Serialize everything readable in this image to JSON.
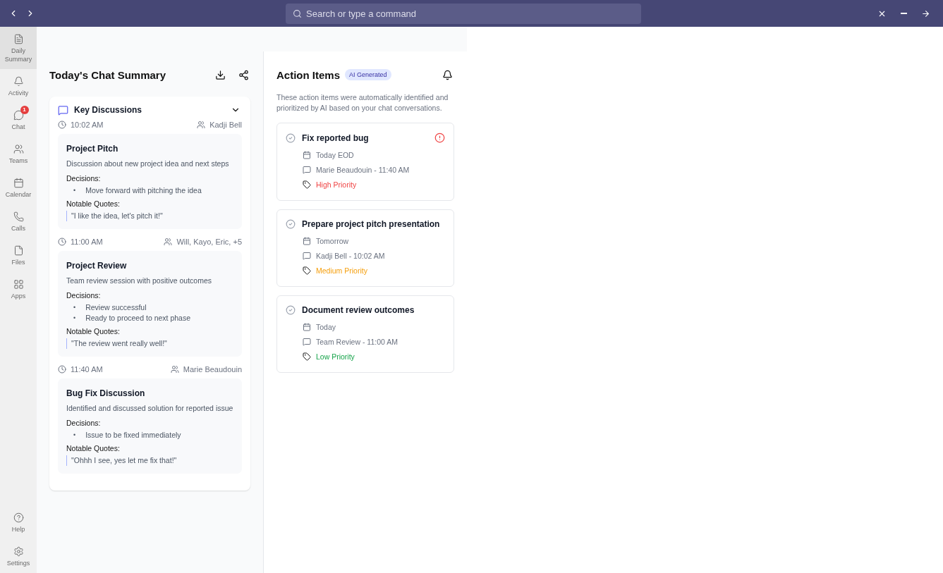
{
  "titlebar": {
    "search": {
      "placeholder": "Search or type a command"
    }
  },
  "sidebar": {
    "items": [
      {
        "kind": "summary",
        "label": "Daily Summary",
        "selected": true
      },
      {
        "kind": "activity",
        "label": "Activity",
        "selected": false
      },
      {
        "kind": "chat",
        "label": "Chat",
        "selected": false,
        "badge": "1"
      },
      {
        "kind": "teams",
        "label": "Teams",
        "selected": false
      },
      {
        "kind": "calendar",
        "label": "Calendar",
        "selected": false
      },
      {
        "kind": "calls",
        "label": "Calls",
        "selected": false
      },
      {
        "kind": "files",
        "label": "Files",
        "selected": false
      },
      {
        "kind": "apps",
        "label": "Apps",
        "selected": false
      }
    ],
    "bottom_items": [
      {
        "kind": "help",
        "label": "Help",
        "selected": false
      },
      {
        "kind": "settings",
        "label": "Settings",
        "selected": false
      }
    ]
  },
  "summary": {
    "title": "Today's Chat Summary",
    "key_discussions": {
      "title": "Key Discussions",
      "expanded": true,
      "bullet": "•",
      "entries": [
        {
          "time": "10:02 AM",
          "participants": "Kadji Bell",
          "title": "Project Pitch",
          "description": "Discussion about new project idea and next steps",
          "decisions_label": "Decisions:",
          "decisions": [
            "Move forward with pitching the idea"
          ],
          "quotes_label": "Notable Quotes:",
          "quotes": [
            "\"I like the idea, let's pitch it!\""
          ]
        },
        {
          "time": "11:00 AM",
          "participants": "Will, Kayo, Eric, +5",
          "title": "Project Review",
          "description": "Team review session with positive outcomes",
          "decisions_label": "Decisions:",
          "decisions": [
            "Review successful",
            "Ready to proceed to next phase"
          ],
          "quotes_label": "Notable Quotes:",
          "quotes": [
            "\"The review went really well!\""
          ]
        },
        {
          "time": "11:40 AM",
          "participants": "Marie Beaudouin",
          "title": "Bug Fix Discussion",
          "description": "Identified and discussed solution for reported issue",
          "decisions_label": "Decisions:",
          "decisions": [
            "Issue to be fixed immediately"
          ],
          "quotes_label": "Notable Quotes:",
          "quotes": [
            "\"Ohhh I see, yes let me fix that!\""
          ]
        }
      ]
    }
  },
  "action_items": {
    "title": "Action Items",
    "badge": "AI Generated",
    "description": "These action items were automatically identified and prioritized by AI based on your chat conversations.",
    "items": [
      {
        "title": "Fix reported bug",
        "due": "Today EOD",
        "source": "Marie Beaudouin - 11:40 AM",
        "priority": "High Priority",
        "kind": "high",
        "flagged": true
      },
      {
        "title": "Prepare project pitch presentation",
        "due": "Tomorrow",
        "source": "Kadji Bell - 10:02 AM",
        "priority": "Medium Priority",
        "kind": "medium",
        "flagged": false
      },
      {
        "title": "Document review outcomes",
        "due": "Today",
        "source": "Team Review - 11:00 AM",
        "priority": "Low Priority",
        "kind": "low",
        "flagged": false
      }
    ]
  }
}
